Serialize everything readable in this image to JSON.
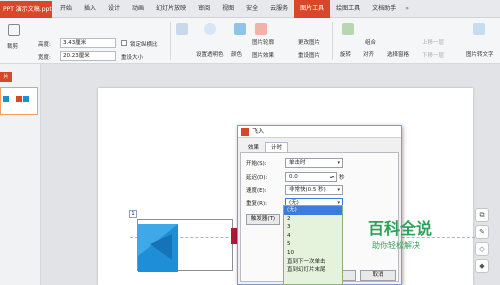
{
  "title_bar": {
    "document_tab": "PPT 演示文稿.ppt",
    "menu": [
      "开始",
      "插入",
      "设计",
      "动画",
      "幻灯片放映",
      "审阅",
      "视图",
      "安全",
      "云服务",
      "图片工具",
      "绘图工具",
      "文档助手"
    ],
    "active_menu": "图片工具",
    "overflow_arrow": "»"
  },
  "ribbon": {
    "crop_label": "裁剪",
    "height_label": "高度:",
    "height_value": "3.43厘米",
    "width_label": "宽度:",
    "width_value": "20.23厘米",
    "lock_ratio_label": "锁定纵横比",
    "reset_size_label": "重设大小",
    "transparent_color_label": "设置透明色",
    "color_label": "颜色",
    "picture_outline_label": "图片轮廓",
    "picture_effect_label": "图片效果",
    "change_picture_label": "更改图片",
    "reset_picture_label": "重设图片",
    "rotate_label": "旋转",
    "align_label": "对齐",
    "group_label": "组合",
    "select_pane_label": "选择窗格",
    "bring_forward_label": "上移一层",
    "send_backward_label": "下移一层",
    "picture_to_text_label": "图片转文字"
  },
  "left_pane": {
    "tab_label": "片",
    "slide_number": "1"
  },
  "dialog": {
    "title": "飞入",
    "tabs": [
      "效果",
      "计时"
    ],
    "active_tab": "计时",
    "start_label": "开始(S):",
    "start_value": "单击时",
    "delay_label": "延迟(D):",
    "delay_value": "0.0",
    "delay_unit": "秒",
    "speed_label": "速度(E):",
    "speed_value": "非常快(0.5 秒)",
    "repeat_label": "重复(R):",
    "repeat_value": "(无)",
    "trigger_button": "触发器(T)",
    "ok_button": "确定",
    "cancel_button": "取消"
  },
  "repeat_dropdown": {
    "options": [
      "(无)",
      "2",
      "3",
      "4",
      "5",
      "10",
      "直到下一次单击",
      "直到幻灯片末尾"
    ],
    "selected_index": 0
  },
  "slide": {
    "badge": "1"
  },
  "watermark": {
    "title": "百科全说",
    "subtitle": "助你轻松解决"
  },
  "colors": {
    "accent": "#d9472b",
    "dropdown_bg": "#e5f3dc",
    "watermark_green": "#2aa35a",
    "image_blue": "#1e8fd6"
  }
}
